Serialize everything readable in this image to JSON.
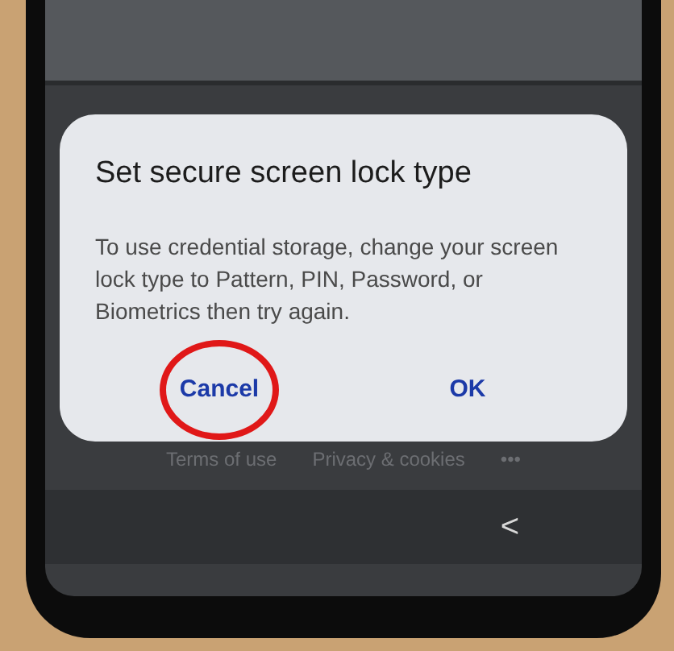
{
  "dialog": {
    "title": "Set secure screen lock type",
    "message": "To use credential storage, change your screen lock type to Pattern, PIN, Password, or Biometrics then try again.",
    "buttons": [
      {
        "label": "Cancel",
        "circled": true
      },
      {
        "label": "OK",
        "circled": false
      }
    ]
  },
  "footer_links": [
    "Terms of use",
    "Privacy & cookies",
    "•••"
  ],
  "nav_bar": {
    "back": "<"
  }
}
